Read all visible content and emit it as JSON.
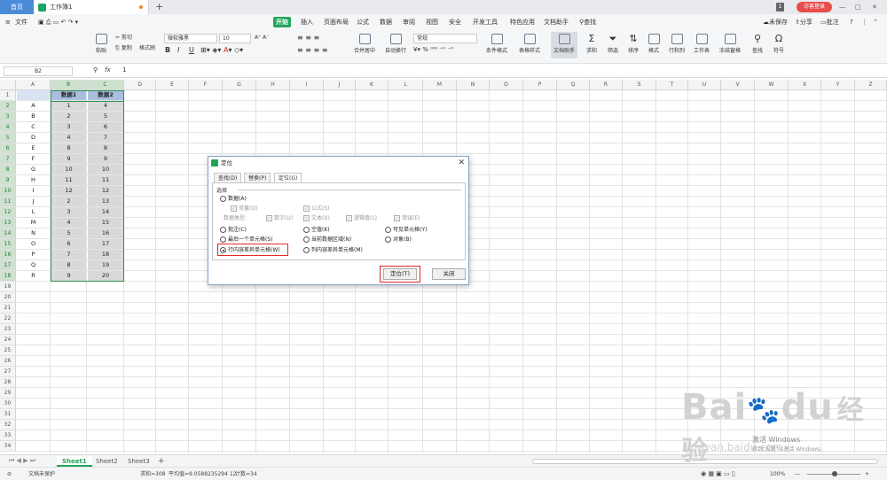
{
  "titlebar": {
    "home_tab": "首页",
    "doc_tab": "工作簿1",
    "add_tab": "+",
    "window_count": "1",
    "login_label": "访客登录",
    "settings_label": "≡"
  },
  "menubar": {
    "file_label": "文件",
    "items": [
      "开始",
      "插入",
      "页面布局",
      "公式",
      "数据",
      "审阅",
      "视图",
      "安全",
      "开发工具",
      "特色应用",
      "文档助手"
    ],
    "search_label": "查找",
    "unsaved_label": "未保存",
    "share_label": "分享",
    "comment_label": "批注"
  },
  "ribbon": {
    "paste": "粘贴",
    "cut": "剪切",
    "copy": "复制",
    "format_painter": "格式刷",
    "font_name": "微软雅黑",
    "font_size": "10",
    "merge_center": "合并居中",
    "wrap_text": "自动换行",
    "number_format": "常规",
    "cond_format": "条件格式",
    "table_style": "表格样式",
    "doc_helper": "文档助手",
    "sum": "求和",
    "filter": "筛选",
    "sort": "排序",
    "format": "格式",
    "rowcol": "行和列",
    "worksheet": "工作表",
    "freeze": "冻结窗格",
    "find": "查找",
    "symbol": "符号",
    "bold": "B",
    "italic": "I",
    "underline": "U"
  },
  "formula_bar": {
    "name_box": "B2",
    "fx": "fx",
    "value": "1"
  },
  "columns": [
    "A",
    "B",
    "C",
    "D",
    "E",
    "F",
    "G",
    "H",
    "I",
    "J",
    "K",
    "L",
    "M",
    "N",
    "O",
    "P",
    "Q",
    "R",
    "S",
    "T",
    "U",
    "V",
    "W",
    "X",
    "Y",
    "Z"
  ],
  "rows": [
    "1",
    "2",
    "3",
    "4",
    "5",
    "6",
    "7",
    "8",
    "9",
    "10",
    "11",
    "12",
    "13",
    "14",
    "15",
    "16",
    "17",
    "18",
    "19",
    "20",
    "21",
    "22",
    "23",
    "24",
    "25",
    "26",
    "27",
    "28",
    "29",
    "30",
    "31",
    "32",
    "33",
    "34"
  ],
  "table": {
    "headers": [
      "数据1",
      "数据2"
    ],
    "col_a": [
      "A",
      "B",
      "C",
      "D",
      "E",
      "F",
      "G",
      "H",
      "I",
      "J",
      "L",
      "M",
      "N",
      "O",
      "P",
      "Q",
      "R"
    ],
    "col_b": [
      "1",
      "2",
      "3",
      "4",
      "8",
      "9",
      "10",
      "11",
      "12",
      "2",
      "3",
      "4",
      "5",
      "6",
      "7",
      "8",
      "9"
    ],
    "col_c": [
      "4",
      "5",
      "6",
      "7",
      "8",
      "9",
      "10",
      "11",
      "12",
      "13",
      "14",
      "15",
      "16",
      "17",
      "18",
      "19",
      "20"
    ]
  },
  "sheets": {
    "tabs": [
      "Sheet1",
      "Sheet2",
      "Sheet3"
    ],
    "active": "Sheet1",
    "add": "+"
  },
  "statusbar": {
    "protect": "文档未保护",
    "sum": "求和=308",
    "avg": "平均值=9.0588235294 12",
    "count": "计数=34",
    "zoom": "100%"
  },
  "dialog": {
    "title": "定位",
    "tabs": [
      "查找(D)",
      "替换(P)",
      "定位(G)"
    ],
    "group_label": "选择",
    "opt_data": "数据(A)",
    "sub_const": "常量(O)",
    "sub_formula": "公式(S)",
    "data_type": "数据类型:",
    "sub_number": "数字(U)",
    "sub_text": "文本(X)",
    "sub_logic": "逻辑值(L)",
    "sub_error": "错误(E)",
    "opt_comment": "批注(C)",
    "opt_blank": "空值(K)",
    "opt_visible": "可见单元格(Y)",
    "opt_last": "最后一个单元格(S)",
    "opt_region": "当前数据区域(N)",
    "opt_object": "对象(B)",
    "opt_row_diff": "行内容差异单元格(W)",
    "opt_col_diff": "列内容差异单元格(M)",
    "locate_btn": "定位(T)",
    "close_btn": "关闭"
  },
  "watermark": {
    "brand": "Bai",
    "brand2": "du",
    "cn": "经验",
    "sub": "jingyan.baidu.com",
    "os_line1": "激活 Windows",
    "os_line2": "转到\"设置\"以激活 Windows。"
  }
}
